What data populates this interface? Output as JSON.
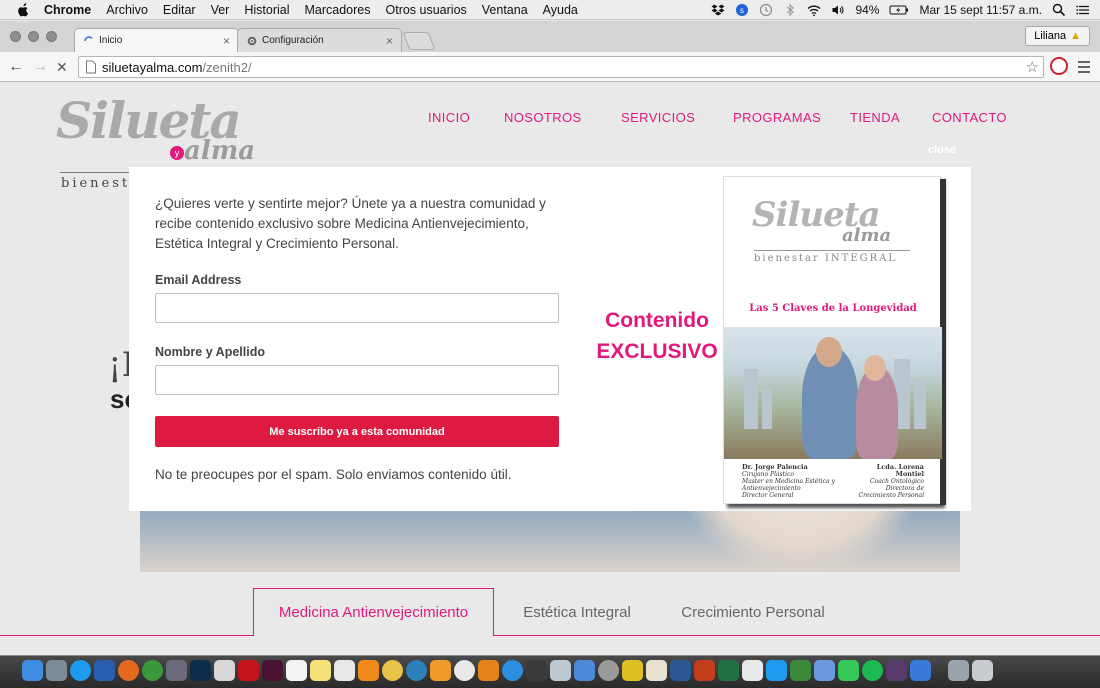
{
  "menubar": {
    "app": "Chrome",
    "items": [
      "Archivo",
      "Editar",
      "Ver",
      "Historial",
      "Marcadores",
      "Otros usuarios",
      "Ventana",
      "Ayuda"
    ],
    "battery": "94%",
    "datetime": "Mar 15 sept  11:57 a.m."
  },
  "tabs": {
    "active": "Inicio",
    "inactive": "Configuración"
  },
  "profile": "Liliana",
  "address": {
    "host": "siluetayalma.com",
    "path": "/zenith2/"
  },
  "site": {
    "logo_main": "Silueta",
    "logo_y": "y",
    "logo_alma": "alma",
    "logo_tag": "bienest",
    "nav": [
      "INICIO",
      "NOSOTROS",
      "SERVICIOS",
      "PROGRAMAS",
      "TIENDA",
      "CONTACTO"
    ],
    "close": "close",
    "bg_line1": "¡I",
    "bg_line2": "so"
  },
  "modal": {
    "intro": "¿Quieres verte y sentirte mejor? Únete ya a nuestra comunidad y recibe contenido exclusivo sobre Medicina Antienvejecimiento, Estética Integral y Crecimiento Personal.",
    "email_label": "Email Address",
    "email_value": "",
    "name_label": "Nombre y Apellido",
    "name_value": "",
    "submit": "Me suscribo ya a esta comunidad",
    "spam": "No te preocupes por el spam. Solo enviamos contenido útil.",
    "promo_line1": "Contenido",
    "promo_line2": "EXCLUSIVO",
    "book": {
      "logo_main": "Silueta",
      "logo_alma": "alma",
      "tag": "bienestar INTEGRAL",
      "title": "Las 5 Claves de la Longevidad",
      "author1_name": "Dr. Jorge Palencia",
      "author1_lines": [
        "Cirujano Plástico",
        "Master en Medicina Estética y",
        "Antienvejecimiento",
        "Director General"
      ],
      "author2_name": "Lcda. Lorena Montiel",
      "author2_lines": [
        "Coach Ontológico",
        "Directora de Crecimiento Personal"
      ]
    }
  },
  "page_tabs": [
    "Medicina Antienvejecimiento",
    "Estética Integral",
    "Crecimiento Personal"
  ],
  "colors": {
    "brand_pink": "#e0197a",
    "button_red": "#dd1a3f"
  }
}
